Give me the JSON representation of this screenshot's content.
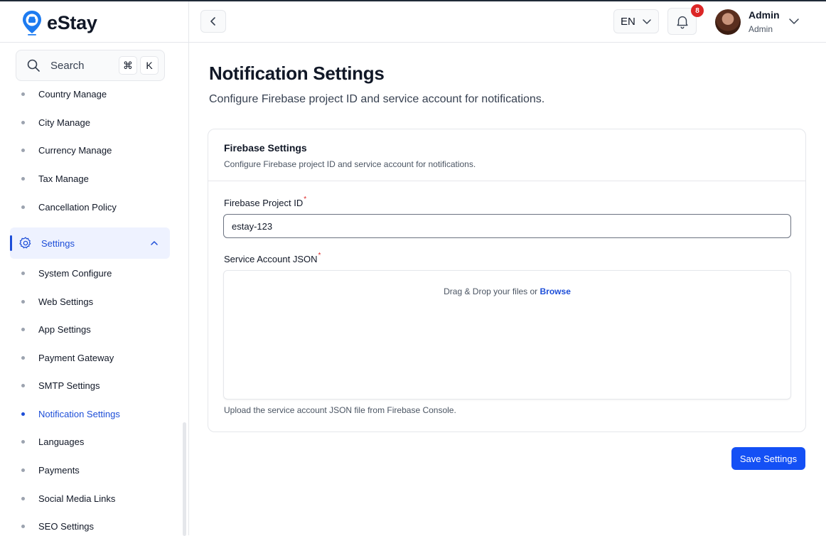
{
  "brand": {
    "name": "eStay",
    "accent": "#1d7bf0"
  },
  "search": {
    "label": "Search",
    "shortcut_mod": "⌘",
    "shortcut_key": "K"
  },
  "sidebar": {
    "items_above": [
      {
        "label": "Country Manage"
      },
      {
        "label": "City Manage"
      },
      {
        "label": "Currency Manage"
      },
      {
        "label": "Tax Manage"
      },
      {
        "label": "Cancellation Policy"
      }
    ],
    "group": {
      "label": "Settings",
      "icon": "gear-icon",
      "expanded": true
    },
    "sub_items": [
      {
        "label": "System Configure"
      },
      {
        "label": "Web Settings"
      },
      {
        "label": "App Settings"
      },
      {
        "label": "Payment Gateway"
      },
      {
        "label": "SMTP Settings"
      },
      {
        "label": "Notification Settings"
      },
      {
        "label": "Languages"
      },
      {
        "label": "Payments"
      },
      {
        "label": "Social Media Links"
      },
      {
        "label": "SEO Settings"
      }
    ],
    "active_item": "Notification Settings"
  },
  "header": {
    "language": "EN",
    "notification_count": "8",
    "user": {
      "name": "Admin",
      "role": "Admin"
    }
  },
  "page": {
    "title": "Notification Settings",
    "subtitle": "Configure Firebase project ID and service account for notifications."
  },
  "card": {
    "title": "Firebase Settings",
    "description": "Configure Firebase project ID and service account for notifications.",
    "project_id_label": "Firebase Project ID",
    "project_id_value": "estay-123",
    "required_mark": "*",
    "json_label": "Service Account JSON",
    "drop_text": "Drag & Drop your files or",
    "browse_label": "Browse",
    "help_text": "Upload the service account JSON file from Firebase Console."
  },
  "actions": {
    "save_label": "Save Settings"
  },
  "colors": {
    "primary": "#1450f5",
    "active_text": "#1d4ed8",
    "badge": "#dc2626",
    "group_bg": "#eef2ff"
  }
}
